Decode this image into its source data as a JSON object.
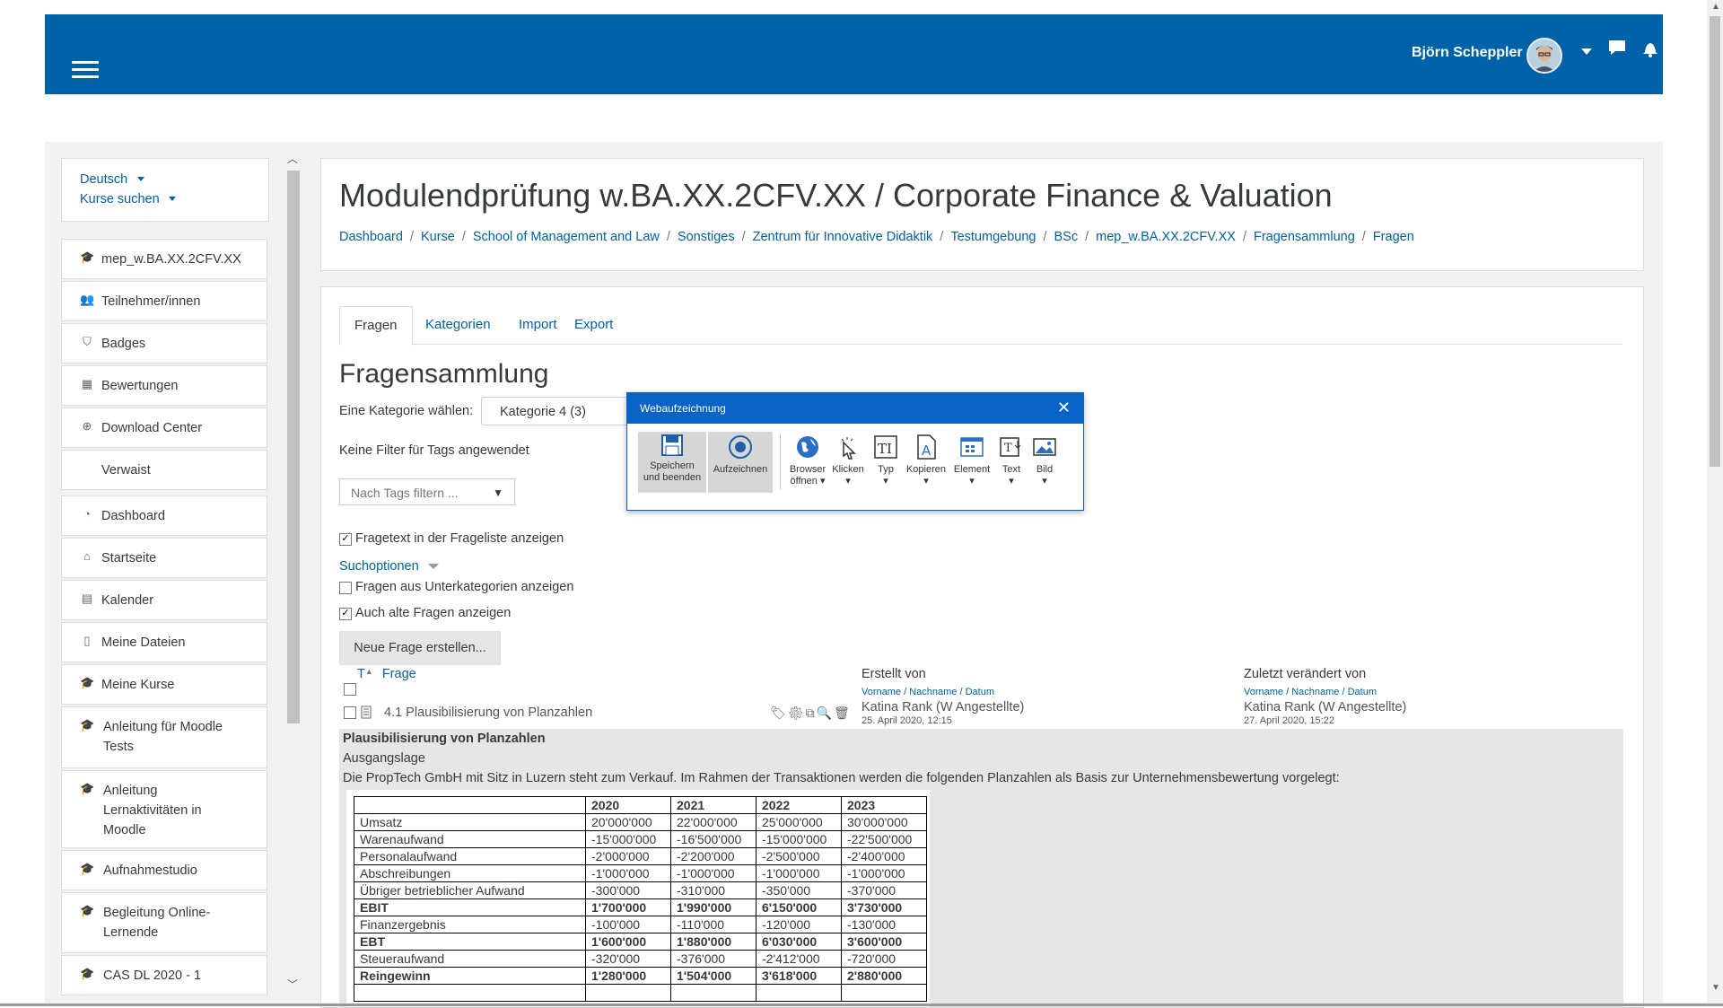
{
  "navbar": {
    "user_name": "Björn Scheppler",
    "icons": [
      "menu-icon",
      "chat-icon",
      "bell-icon"
    ],
    "brand_color": "#0062a8"
  },
  "sidebar": {
    "lang_label": "Deutsch",
    "search_label": "Kurse suchen",
    "items": [
      {
        "label": "mep_w.BA.XX.2CFV.XX",
        "icon": "graduation-cap-icon"
      },
      {
        "label": "Teilnehmer/innen",
        "icon": "users-icon"
      },
      {
        "label": "Badges",
        "icon": "shield-icon"
      },
      {
        "label": "Bewertungen",
        "icon": "table-icon"
      },
      {
        "label": "Download Center",
        "icon": "download-icon"
      },
      {
        "label": "Verwaist",
        "icon": ""
      },
      {
        "label": "Dashboard",
        "icon": "dashboard-icon"
      },
      {
        "label": "Startseite",
        "icon": "home-icon"
      },
      {
        "label": "Kalender",
        "icon": "calendar-icon"
      },
      {
        "label": "Meine Dateien",
        "icon": "file-icon"
      },
      {
        "label": "Meine Kurse",
        "icon": "graduation-cap-icon"
      },
      {
        "label": "Anleitung für Moodle Tests",
        "icon": "graduation-cap-icon"
      },
      {
        "label": "Anleitung Lernaktivitäten in Moodle",
        "icon": "graduation-cap-icon"
      },
      {
        "label": "Aufnahmestudio",
        "icon": "graduation-cap-icon"
      },
      {
        "label": "Begleitung Online-Lernende",
        "icon": "graduation-cap-icon"
      },
      {
        "label": "CAS DL 2020 - 1",
        "icon": "graduation-cap-icon"
      }
    ]
  },
  "header": {
    "title": "Modulendprüfung w.BA.XX.2CFV.XX / Corporate Finance & Valuation",
    "breadcrumb": [
      "Dashboard",
      "Kurse",
      "School of Management and Law",
      "Sonstiges",
      "Zentrum für Innovative Didaktik",
      "Testumgebung",
      "BSc",
      "mep_w.BA.XX.2CFV.XX",
      "Fragensammlung",
      "Fragen"
    ]
  },
  "tabs": [
    "Fragen",
    "Kategorien",
    "Import",
    "Export"
  ],
  "main": {
    "section_title": "Fragensammlung",
    "category_label": "Eine Kategorie wählen:",
    "category_value": "Kategorie 4 (3)",
    "no_filter": "Keine Filter für Tags angewendet",
    "tag_placeholder": "Nach Tags filtern ...",
    "show_text_label": "Fragetext in der Frageliste anzeigen",
    "search_options": "Suchoptionen",
    "subcat_label": "Fragen aus Unterkategorien anzeigen",
    "old_label": "Auch alte Fragen anzeigen",
    "new_button": "Neue Frage erstellen...",
    "col_t": "T",
    "col_frage": "Frage",
    "col_created": "Erstellt von",
    "col_modified": "Zuletzt verändert von",
    "sort_first": "Vorname",
    "sort_last": "Nachname",
    "sort_date": "Datum",
    "sort_sep": " / ",
    "question_name": "4.1 Plausibilisierung von Planzahlen",
    "created_by": "Katina Rank (W Angestellte)",
    "created_date": "25. April 2020, 12:15",
    "modified_by": "Katina Rank (W Angestellte)",
    "modified_date": "27. April 2020, 15:22",
    "preview_title": "Plausibilisierung von Planzahlen",
    "preview_sub": "Ausgangslage",
    "preview_desc": "Die PropTech GmbH mit Sitz in Luzern steht zum Verkauf. Im Rahmen der Transaktionen werden die folgenden Planzahlen als Basis zur Unternehmensbewertung vorgelegt:"
  },
  "fin_table": {
    "years": [
      "2020",
      "2021",
      "2022",
      "2023"
    ],
    "rows": [
      {
        "label": "Umsatz",
        "values": [
          "20'000'000",
          "22'000'000",
          "25'000'000",
          "30'000'000"
        ],
        "bold": false
      },
      {
        "label": "Warenaufwand",
        "values": [
          "-15'000'000",
          "-16'500'000",
          "-15'000'000",
          "-22'500'000"
        ],
        "bold": false
      },
      {
        "label": "Personalaufwand",
        "values": [
          "-2'000'000",
          "-2'200'000",
          "-2'500'000",
          "-2'400'000"
        ],
        "bold": false
      },
      {
        "label": "Abschreibungen",
        "values": [
          "-1'000'000",
          "-1'000'000",
          "-1'000'000",
          "-1'000'000"
        ],
        "bold": false
      },
      {
        "label": "Übriger betrieblicher Aufwand",
        "values": [
          "-300'000",
          "-310'000",
          "-350'000",
          "-370'000"
        ],
        "bold": false
      },
      {
        "label": "EBIT",
        "values": [
          "1'700'000",
          "1'990'000",
          "6'150'000",
          "3'730'000"
        ],
        "bold": true
      },
      {
        "label": "Finanzergebnis",
        "values": [
          "-100'000",
          "-110'000",
          "-120'000",
          "-130'000"
        ],
        "bold": false
      },
      {
        "label": "EBT",
        "values": [
          "1'600'000",
          "1'880'000",
          "6'030'000",
          "3'600'000"
        ],
        "bold": true
      },
      {
        "label": "Steueraufwand",
        "values": [
          "-320'000",
          "-376'000",
          "-2'412'000",
          "-720'000"
        ],
        "bold": false
      },
      {
        "label": "Reingewinn",
        "values": [
          "1'280'000",
          "1'504'000",
          "3'618'000",
          "2'880'000"
        ],
        "bold": true
      }
    ]
  },
  "dialog": {
    "title": "Webaufzeichnung",
    "save_line1": "Speichern",
    "save_line2": "und beenden",
    "record": "Aufzeichnen",
    "browser_line1": "Browser",
    "browser_line2": "öffnen",
    "click": "Klicken",
    "type": "Typ",
    "copy": "Kopieren",
    "element": "Element",
    "text": "Text",
    "image": "Bild"
  }
}
